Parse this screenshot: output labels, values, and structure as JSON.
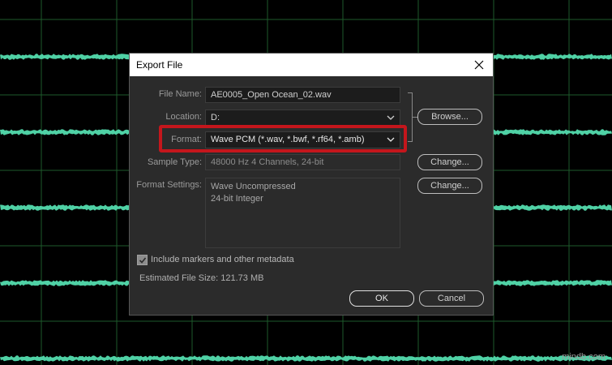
{
  "dialog": {
    "title": "Export File",
    "file_name_label": "File Name:",
    "file_name_value": "AE0005_Open Ocean_02.wav",
    "location_label": "Location:",
    "location_value": "D:",
    "browse_label": "Browse...",
    "format_label": "Format:",
    "format_value": "Wave PCM (*.wav, *.bwf, *.rf64, *.amb)",
    "sample_type_label": "Sample Type:",
    "sample_type_value": "48000 Hz 4 Channels, 24-bit",
    "change_label": "Change...",
    "format_settings_label": "Format Settings:",
    "format_settings_line1": "Wave Uncompressed",
    "format_settings_line2": "24-bit Integer",
    "format_settings_change_label": "Change...",
    "metadata_checkbox_label": "Include markers and other metadata",
    "metadata_checked": true,
    "estimated_size_label": "Estimated File Size: 121.73 MB",
    "ok_label": "OK",
    "cancel_label": "Cancel"
  },
  "watermark": "mindb.com",
  "colors": {
    "waveform": "#4fd1a5",
    "grid": "#1e5a2b",
    "highlight": "#c4161c",
    "dialog_bg": "#2b2b2b"
  }
}
